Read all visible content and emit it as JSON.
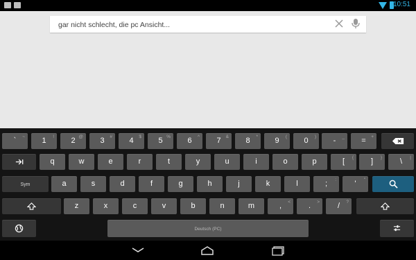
{
  "status": {
    "time": "10:51"
  },
  "search": {
    "value": "gar nicht schlecht, die pc Ansicht..."
  },
  "keyboard": {
    "row1": [
      {
        "label": "`",
        "hint": "~"
      },
      {
        "label": "1",
        "hint": "!"
      },
      {
        "label": "2",
        "hint": "@"
      },
      {
        "label": "3",
        "hint": "#"
      },
      {
        "label": "4",
        "hint": "$"
      },
      {
        "label": "5",
        "hint": "%"
      },
      {
        "label": "6",
        "hint": "^"
      },
      {
        "label": "7",
        "hint": "&"
      },
      {
        "label": "8",
        "hint": "*"
      },
      {
        "label": "9",
        "hint": "("
      },
      {
        "label": "0",
        "hint": ")"
      },
      {
        "label": "-",
        "hint": "_"
      },
      {
        "label": "=",
        "hint": "+"
      }
    ],
    "row2": [
      {
        "label": "q"
      },
      {
        "label": "w"
      },
      {
        "label": "e"
      },
      {
        "label": "r"
      },
      {
        "label": "t"
      },
      {
        "label": "y"
      },
      {
        "label": "u"
      },
      {
        "label": "i"
      },
      {
        "label": "o"
      },
      {
        "label": "p"
      },
      {
        "label": "[",
        "hint": "{"
      },
      {
        "label": "]",
        "hint": "}"
      },
      {
        "label": "\\",
        "hint": "|"
      }
    ],
    "row3": [
      {
        "label": "a"
      },
      {
        "label": "s"
      },
      {
        "label": "d"
      },
      {
        "label": "f"
      },
      {
        "label": "g"
      },
      {
        "label": "h"
      },
      {
        "label": "j"
      },
      {
        "label": "k"
      },
      {
        "label": "l"
      },
      {
        "label": ";",
        "hint": ":"
      },
      {
        "label": "'",
        "hint": "\""
      }
    ],
    "row4": [
      {
        "label": "z"
      },
      {
        "label": "x"
      },
      {
        "label": "c"
      },
      {
        "label": "v"
      },
      {
        "label": "b"
      },
      {
        "label": "n"
      },
      {
        "label": "m"
      },
      {
        "label": ",",
        "hint": "<"
      },
      {
        "label": ".",
        "hint": ">"
      },
      {
        "label": "/",
        "hint": "?"
      }
    ],
    "sym_label": "Sym",
    "space_label": "Deutsch (PC)"
  }
}
